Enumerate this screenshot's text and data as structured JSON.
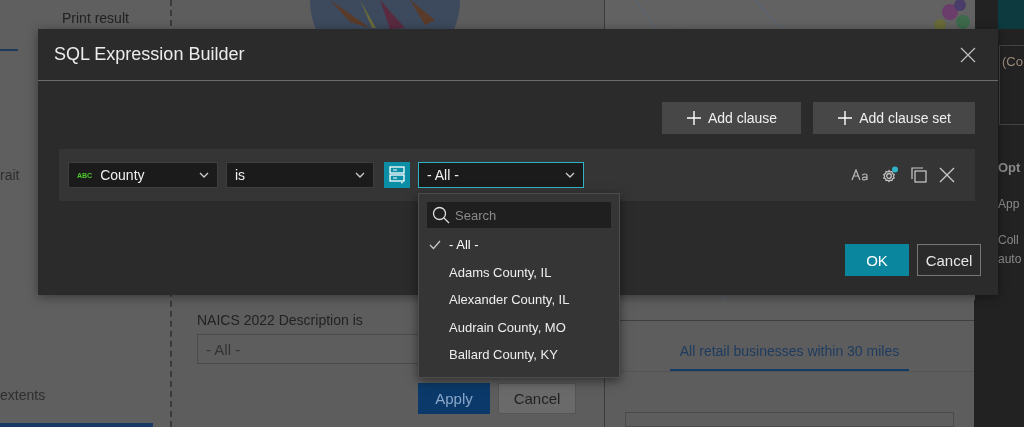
{
  "background": {
    "left_panel": {
      "tab_label": "Print result",
      "items": [
        "rait",
        "extents"
      ]
    },
    "filter_panel": {
      "label": "NAICS 2022 Description is",
      "value": "- All -",
      "buttons": [
        "Apply",
        "Cancel"
      ]
    },
    "results_panel": {
      "tabs": [
        {
          "label": "All retail businesses within 30 miles",
          "selected": true
        }
      ]
    },
    "right_panel": {
      "field_value": "(Co",
      "items": [
        "Opt",
        "App",
        "Coll",
        "auto"
      ]
    }
  },
  "dialog": {
    "title": "SQL Expression Builder",
    "actions": [
      "Add clause",
      "Add clause set"
    ],
    "clause": {
      "field_type": "ABC",
      "field": "County",
      "operator": "is",
      "value": "- All -"
    },
    "dropdown": {
      "search_placeholder": "Search",
      "options": [
        {
          "label": "- All -",
          "selected": true
        },
        {
          "label": "Adams County, IL",
          "selected": false
        },
        {
          "label": "Alexander County, IL",
          "selected": false
        },
        {
          "label": "Audrain County, MO",
          "selected": false
        },
        {
          "label": "Ballard County, KY",
          "selected": false
        }
      ]
    },
    "buttons": [
      "OK",
      "Cancel"
    ]
  }
}
